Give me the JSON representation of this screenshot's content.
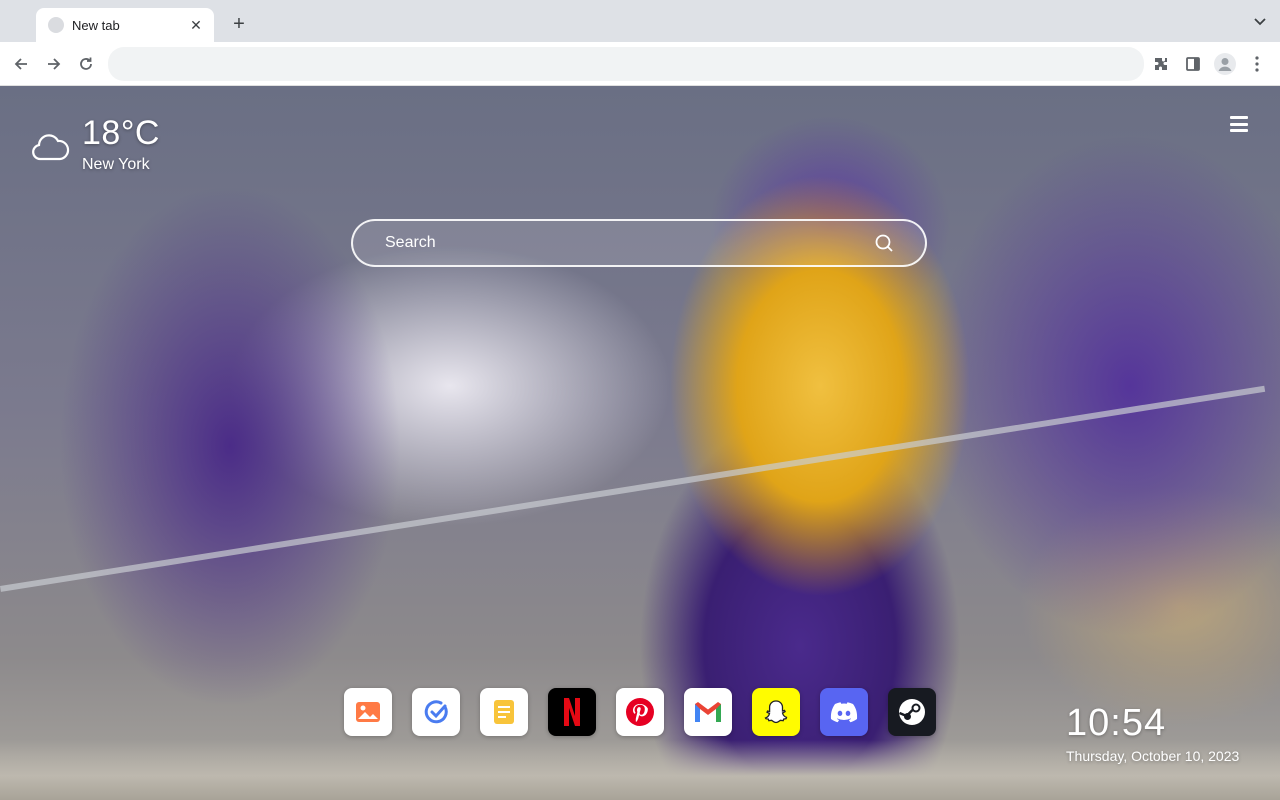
{
  "browser": {
    "tab": {
      "title": "New tab",
      "close_glyph": "✕",
      "favicon": "globe-icon"
    },
    "new_tab_glyph": "+",
    "omnibox": {
      "value": "",
      "placeholder": ""
    },
    "toolbar_icons": [
      "back-arrow-icon",
      "forward-arrow-icon",
      "reload-icon",
      "extensions-icon",
      "side-panel-icon",
      "profile-avatar-icon",
      "more-vert-icon"
    ]
  },
  "weather": {
    "temperature": "18°C",
    "city": "New York",
    "icon": "cloud-icon"
  },
  "search": {
    "placeholder": "Search",
    "value": ""
  },
  "apps": [
    {
      "name": "gallery",
      "icon": "image-icon",
      "bg": "#ffffff"
    },
    {
      "name": "tasks",
      "icon": "check-circle-icon",
      "bg": "#ffffff"
    },
    {
      "name": "notes",
      "icon": "note-icon",
      "bg": "#ffffff"
    },
    {
      "name": "netflix",
      "icon": "netflix-icon",
      "bg": "#000000"
    },
    {
      "name": "pinterest",
      "icon": "pinterest-icon",
      "bg": "#ffffff"
    },
    {
      "name": "gmail",
      "icon": "gmail-icon",
      "bg": "#ffffff"
    },
    {
      "name": "snapchat",
      "icon": "snapchat-icon",
      "bg": "#fffc00"
    },
    {
      "name": "discord",
      "icon": "discord-icon",
      "bg": "#5865f2"
    },
    {
      "name": "steam",
      "icon": "steam-icon",
      "bg": "#171a21"
    }
  ],
  "clock": {
    "time": "10:54",
    "date": "Thursday, October 10, 2023"
  },
  "colors": {
    "tabstrip": "#dee1e6",
    "accent_purple": "#4b2c88",
    "accent_gold": "#f0c040"
  }
}
